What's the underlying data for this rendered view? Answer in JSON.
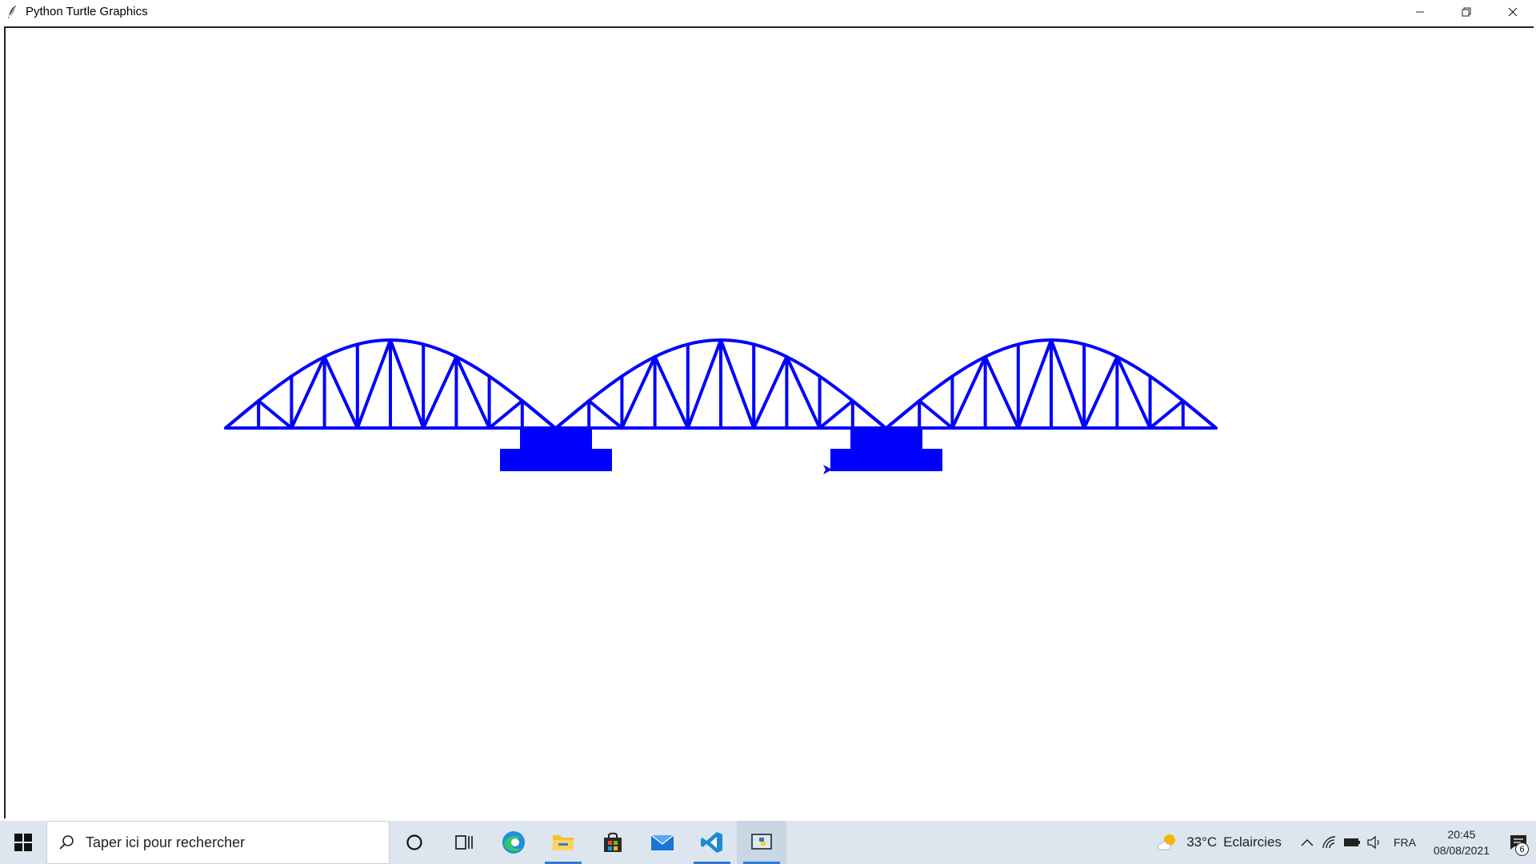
{
  "window": {
    "title": "Python Turtle Graphics",
    "icon": "feather-icon",
    "controls": [
      "minimize-icon",
      "restore-icon",
      "close-icon"
    ]
  },
  "canvas": {
    "stroke_color": "#0000ff",
    "fill_color": "#0000ff",
    "background": "#ffffff"
  },
  "taskbar": {
    "search_placeholder": "Taper ici pour rechercher",
    "apps": [
      {
        "name": "cortana",
        "icon": "circle-icon"
      },
      {
        "name": "task-view",
        "icon": "task-view-icon"
      },
      {
        "name": "edge",
        "icon": "edge-icon"
      },
      {
        "name": "file-explorer",
        "icon": "folder-icon"
      },
      {
        "name": "store",
        "icon": "store-icon"
      },
      {
        "name": "mail",
        "icon": "mail-icon"
      },
      {
        "name": "vscode",
        "icon": "vscode-icon"
      },
      {
        "name": "python",
        "icon": "python-icon"
      }
    ],
    "weather": {
      "temp": "33°C",
      "condition": "Eclaircies",
      "icon": "partly-sunny-icon"
    },
    "language": "FRA",
    "time": "20:45",
    "date": "08/08/2021",
    "notifications_count": "6",
    "accent_color": "#2f7bd4"
  }
}
